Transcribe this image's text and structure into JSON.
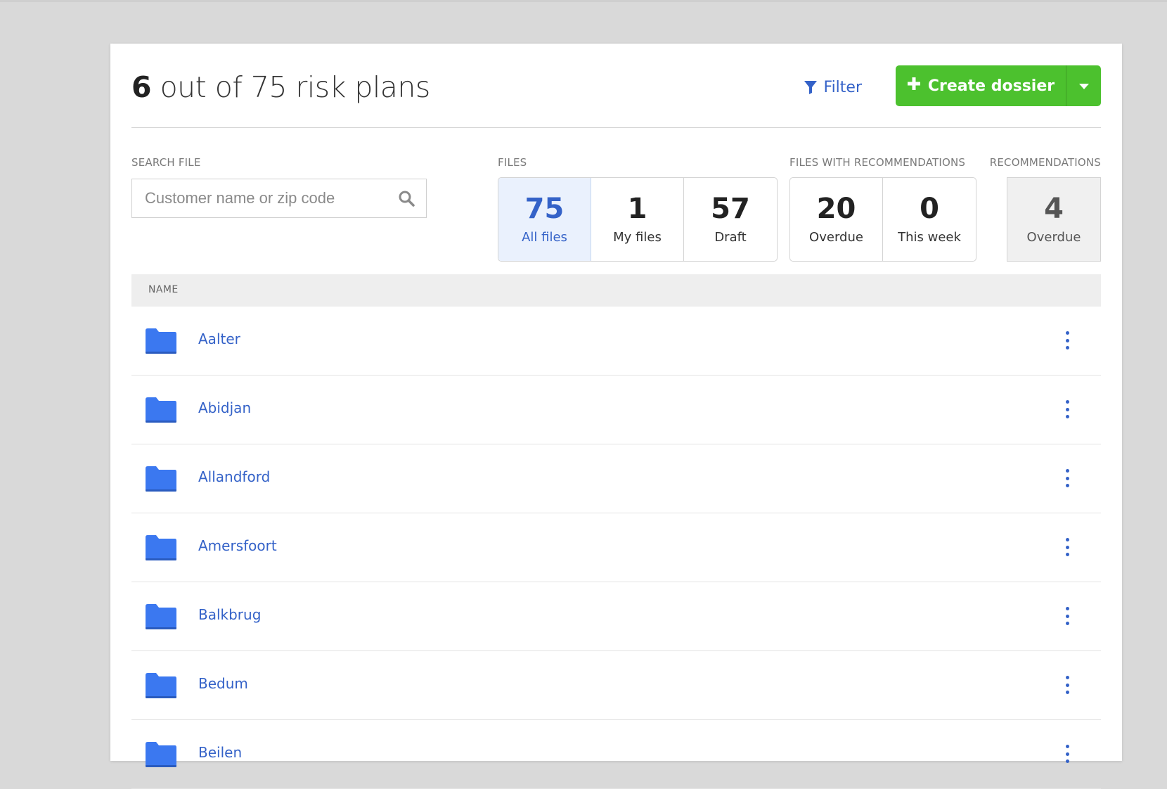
{
  "header": {
    "title_count": "6",
    "title_rest": " out of 75 risk plans",
    "filter_label": "Filter",
    "create_label": "Create dossier"
  },
  "search": {
    "label": "SEARCH FILE",
    "placeholder": "Customer name or zip code"
  },
  "files": {
    "label": "FILES",
    "stats": [
      {
        "value": "75",
        "label": "All files",
        "active": true
      },
      {
        "value": "1",
        "label": "My files"
      },
      {
        "value": "57",
        "label": "Draft"
      }
    ]
  },
  "files_with_recommendations": {
    "label": "FILES WITH RECOMMENDATIONS",
    "stats": [
      {
        "value": "20",
        "label": "Overdue"
      },
      {
        "value": "0",
        "label": "This week"
      }
    ]
  },
  "recommendations": {
    "label": "RECOMMENDATIONS",
    "stats": [
      {
        "value": "4",
        "label": "Overdue"
      }
    ]
  },
  "table": {
    "column_name": "NAME",
    "rows": [
      {
        "name": "Aalter"
      },
      {
        "name": "Abidjan"
      },
      {
        "name": "Allandford"
      },
      {
        "name": "Amersfoort"
      },
      {
        "name": "Balkbrug"
      },
      {
        "name": "Bedum"
      },
      {
        "name": "Beilen"
      }
    ]
  },
  "colors": {
    "accent": "#3462c8",
    "create_button": "#4cc12e",
    "folder": "#3b78f0"
  }
}
